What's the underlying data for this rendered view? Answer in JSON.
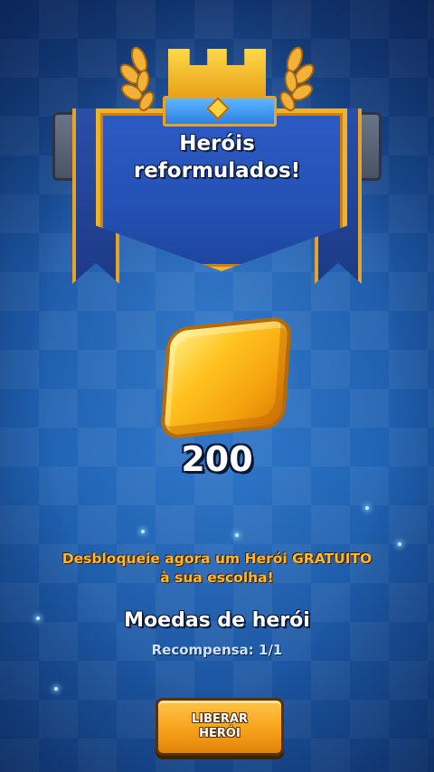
{
  "banner": {
    "title_line1": "Heróis",
    "title_line2": "reformulados!"
  },
  "reward": {
    "amount": "200",
    "description_line1": "Desbloqueie agora um Herói GRATUITO",
    "description_line2": "à sua escolha!",
    "title": "Moedas de herói",
    "count_label": "Recompensa: 1/1"
  },
  "action": {
    "button_label": "LIBERAR\nHERÓI"
  },
  "colors": {
    "background": "#1f4f96",
    "gold": "#f0b12e",
    "button": "#f8a21a",
    "description_text": "#ffb72e"
  },
  "icons": [
    "crown-icon",
    "laurel-icon",
    "hero-coin-icon"
  ]
}
